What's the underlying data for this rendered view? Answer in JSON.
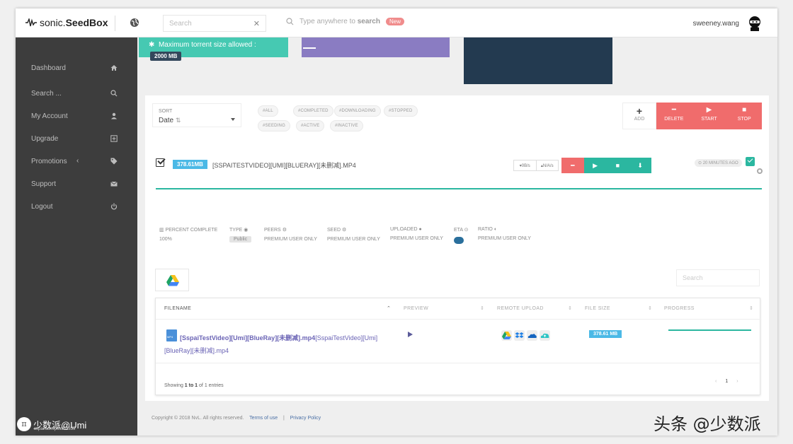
{
  "app": {
    "logo_light": "sonic.",
    "logo_bold": "SeedBox"
  },
  "header": {
    "search_placeholder": "Search",
    "any_search_prefix": "Type anywhere to ",
    "any_search_bold": "search",
    "new_badge": "New",
    "username": "sweeney.wang"
  },
  "sidebar": {
    "items": [
      {
        "label": "Dashboard",
        "icon": "home-icon"
      },
      {
        "label": "Search ...",
        "icon": "search-icon"
      },
      {
        "label": "My Account",
        "icon": "user-icon"
      },
      {
        "label": "Upgrade",
        "icon": "plus-square-icon"
      },
      {
        "label": "Promotions",
        "icon": "tag-icon"
      },
      {
        "label": "Support",
        "icon": "envelope-icon"
      },
      {
        "label": "Logout",
        "icon": "power-icon"
      }
    ]
  },
  "stats_cards": {
    "max_size_label": "Maximum torrent size allowed :",
    "max_size_value": "2000 MB"
  },
  "toolbar": {
    "sort_caption": "SORT",
    "sort_value": "Date",
    "tags": [
      "#ALL",
      "#COMPLETED",
      "#DOWNLOADING",
      "#STOPPED",
      "#SEEDING",
      "#ACTIVE",
      "#INACTIVE"
    ],
    "add_label": "ADD",
    "delete_label": "DELETE",
    "start_label": "START",
    "stop_label": "STOP"
  },
  "torrent": {
    "size": "378.61MB",
    "name": "[SSPAITESTVIDEO][UMI][BLUERAY][未删减].MP4",
    "down_speed": "0B/s",
    "up_speed": "N/A/s",
    "time_ago": "20 MINUTES AGO",
    "details": {
      "percent_label": "PERCENT COMPLETE",
      "percent_value": "100%",
      "type_label": "TYPE",
      "type_value": "Public",
      "peers_label": "PEERS",
      "peers_value": "PREMIUM USER ONLY",
      "seed_label": "SEED",
      "seed_value": "PREMIUM USER ONLY",
      "uploaded_label": "UPLOADED",
      "uploaded_value": "PREMIUM USER ONLY",
      "eta_label": "ETA",
      "ratio_label": "RATIO",
      "ratio_value": "PREMIUM USER ONLY"
    }
  },
  "files": {
    "search_placeholder": "Search",
    "columns": [
      "FILENAME",
      "PREVIEW",
      "REMOTE UPLOAD",
      "FILE SIZE",
      "PROGRESS"
    ],
    "row": {
      "name_bold": "[SspaiTestVideo][Umi][BlueRay][未删减].mp4",
      "name_rest": "[SspaiTestVideo][Umi][BlueRay][未删减].mp4",
      "size": "378.61 MB",
      "progress": 1.0
    },
    "showing_prefix": "Showing ",
    "showing_range": "1 to 1",
    "showing_suffix": " of 1 entries",
    "page": "1"
  },
  "footer": {
    "copyright": "Copyright © 2018 NvL. All rights reserved.",
    "terms": "Terms of use",
    "sep": "|",
    "privacy": "Privacy Policy"
  },
  "watermarks": {
    "left_text": "少数派@Umi",
    "left_sub": "sspai.com/post/51855",
    "right_text": "头条 @少数派"
  },
  "colors": {
    "teal": "#2bb7a0",
    "red": "#f06c6c",
    "blue_badge": "#4bb9e6",
    "purple": "#8a7cc2",
    "navy": "#233a50",
    "sidebar": "#3d3d3d"
  }
}
